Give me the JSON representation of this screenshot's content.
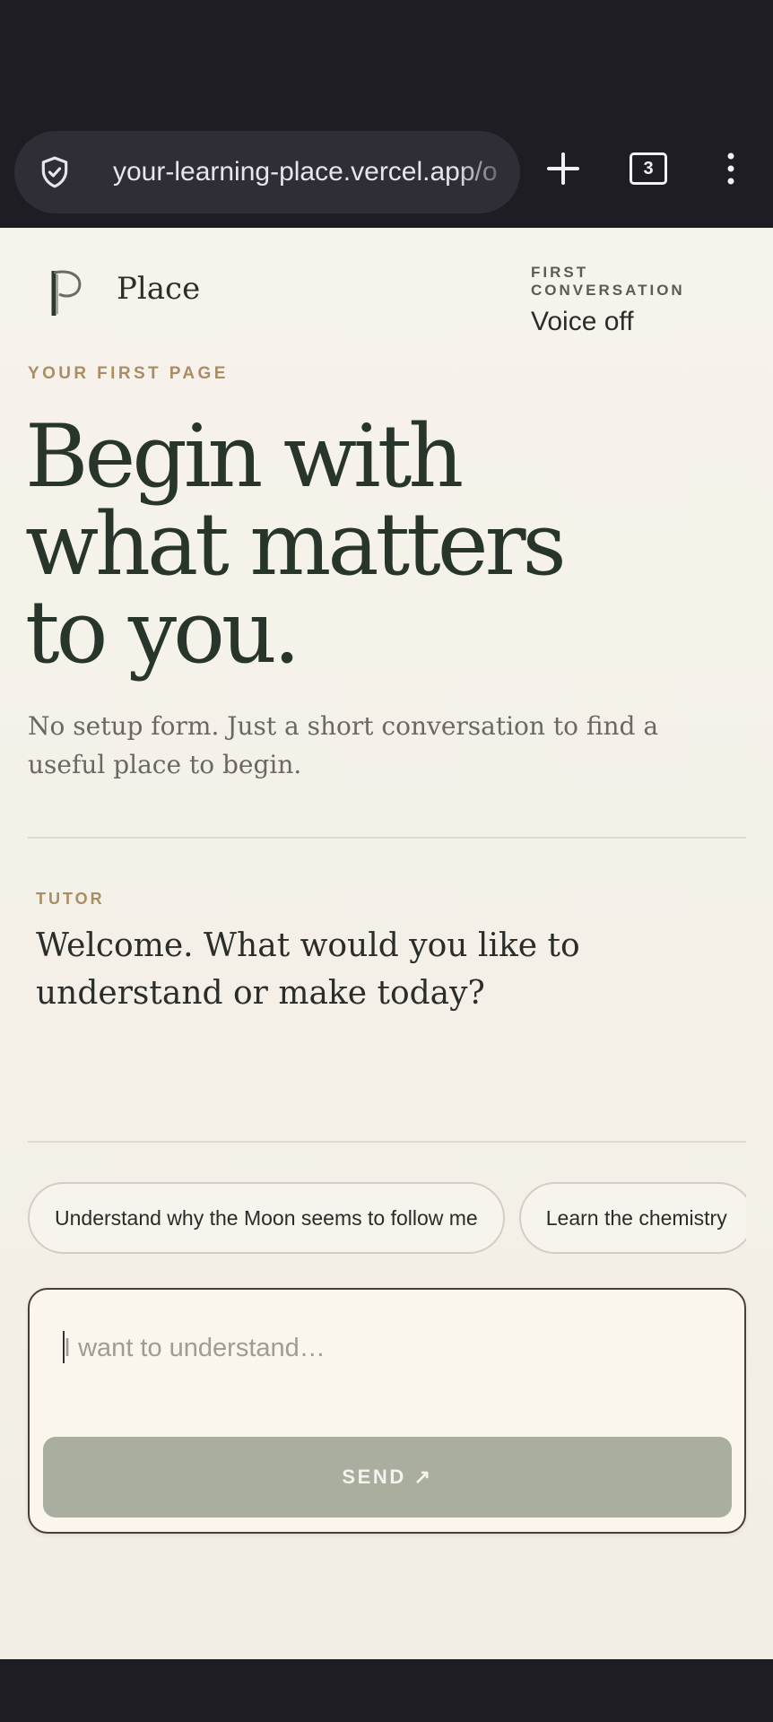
{
  "browser": {
    "url": "your-learning-place.vercel.app/o",
    "tab_count": "3",
    "icons": {
      "security": "shield-check-icon",
      "new_tab": "plus-icon",
      "tabs": "tab-switcher-icon",
      "menu": "kebab-menu-icon"
    }
  },
  "header": {
    "brand_name": "Place",
    "conversation_label": "FIRST CONVERSATION",
    "voice_status": "Voice off"
  },
  "hero": {
    "kicker": "YOUR FIRST PAGE",
    "headline_line1": "Begin with",
    "headline_line2": "what matters",
    "headline_line3": "to you.",
    "subtitle": "No setup form. Just a short conversation to find a useful place to begin."
  },
  "tutor": {
    "label": "TUTOR",
    "message": "Welcome. What would you like to understand or make today?"
  },
  "suggestions": [
    "Understand why the Moon seems to follow me",
    "Learn the chemistry"
  ],
  "composer": {
    "placeholder": "I want to understand…",
    "send_label": "SEND ↗"
  },
  "colors": {
    "accent_kicker": "#a98e64",
    "headline": "#28352a",
    "page_bg": "#f4f0e8",
    "send_disabled": "#a9ae9f",
    "chrome_bg": "#1e1d24"
  }
}
